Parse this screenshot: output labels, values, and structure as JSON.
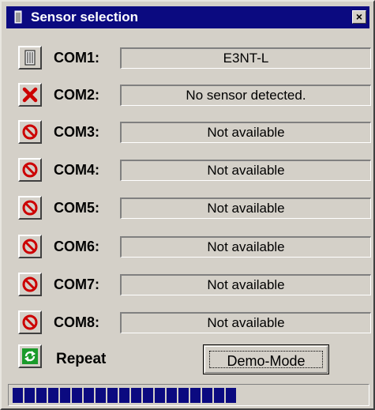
{
  "window": {
    "title": "Sensor selection",
    "close_glyph": "×"
  },
  "ports": [
    {
      "label": "COM1:",
      "status": "E3NT-L",
      "icon": "sensor-icon"
    },
    {
      "label": "COM2:",
      "status": "No sensor detected.",
      "icon": "red-x-icon"
    },
    {
      "label": "COM3:",
      "status": "Not available",
      "icon": "no-entry-icon"
    },
    {
      "label": "COM4:",
      "status": "Not available",
      "icon": "no-entry-icon"
    },
    {
      "label": "COM5:",
      "status": "Not available",
      "icon": "no-entry-icon"
    },
    {
      "label": "COM6:",
      "status": "Not available",
      "icon": "no-entry-icon"
    },
    {
      "label": "COM7:",
      "status": "Not available",
      "icon": "no-entry-icon"
    },
    {
      "label": "COM8:",
      "status": "Not available",
      "icon": "no-entry-icon"
    }
  ],
  "repeat": {
    "label": "Repeat",
    "icon": "refresh-icon"
  },
  "demo": {
    "label": "Demo-Mode"
  },
  "progress": {
    "fraction": 0.64
  },
  "colors": {
    "title_bar": "#0b0a80",
    "face": "#d4d0c8",
    "error_red": "#cc0000",
    "refresh_green": "#1a9b2a"
  }
}
